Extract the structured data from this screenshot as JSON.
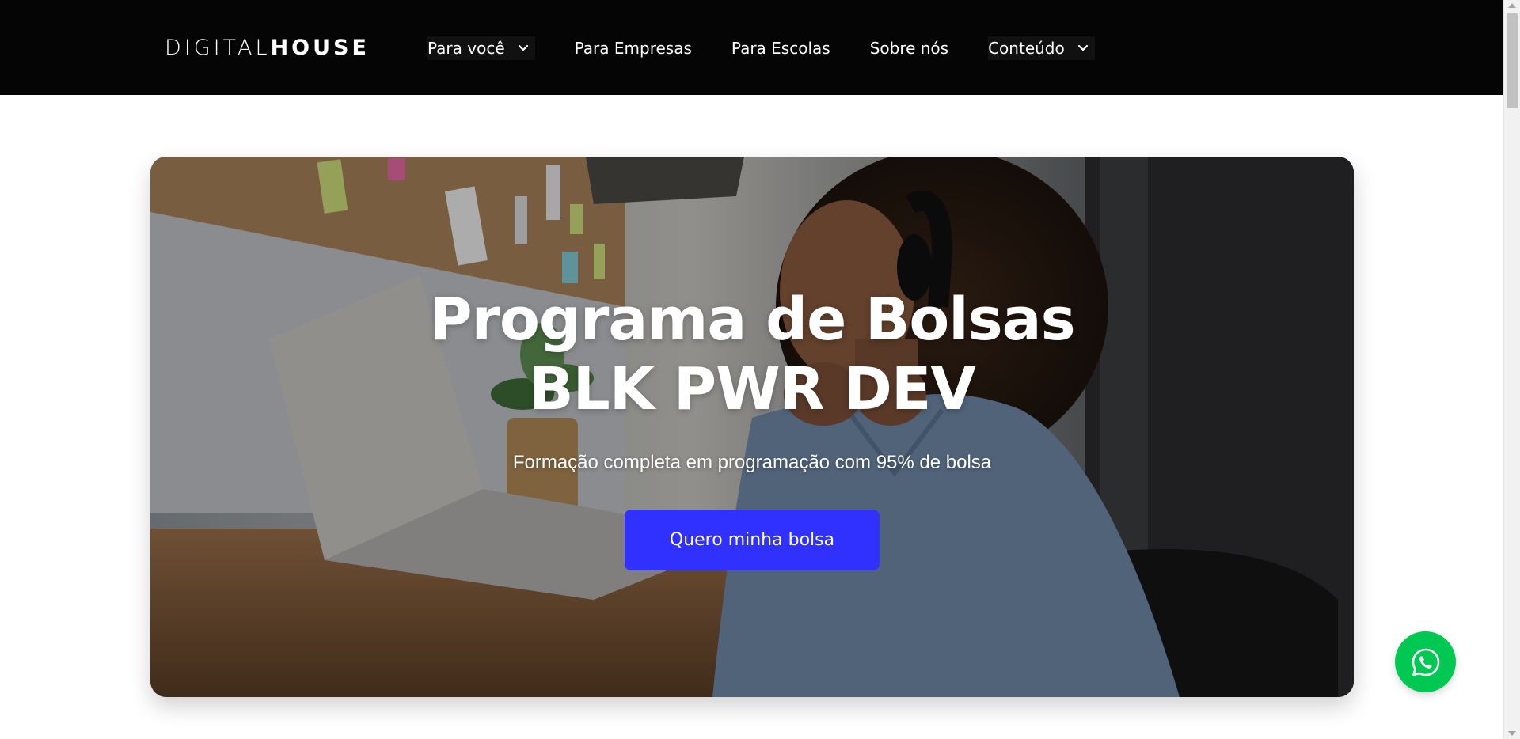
{
  "header": {
    "logo_light": "DIGITAL",
    "logo_bold": "HOUSE",
    "nav": [
      {
        "label": "Para você",
        "has_dropdown": true
      },
      {
        "label": "Para Empresas",
        "has_dropdown": false
      },
      {
        "label": "Para Escolas",
        "has_dropdown": false
      },
      {
        "label": "Sobre nós",
        "has_dropdown": false
      },
      {
        "label": "Conteúdo",
        "has_dropdown": true
      }
    ]
  },
  "hero": {
    "title_line1": "Programa de Bolsas",
    "title_line2": "BLK PWR DEV",
    "subtitle": "Formação completa em programação com 95% de bolsa",
    "cta_label": "Quero minha bolsa"
  },
  "icons": {
    "dropdown": "chevron-down-icon",
    "whatsapp": "whatsapp-icon"
  },
  "colors": {
    "header_bg": "#050505",
    "cta_bg": "#3131ff",
    "whatsapp_bg": "#00c853"
  }
}
